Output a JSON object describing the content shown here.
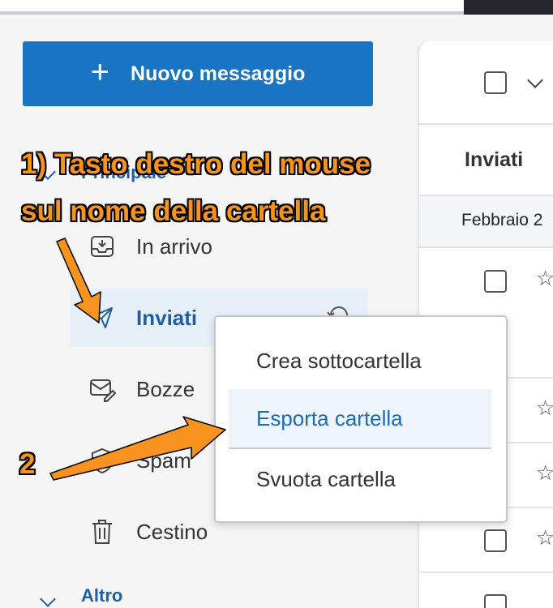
{
  "toolbar": {
    "new_message": "Nuovo messaggio"
  },
  "sidebar": {
    "section_main": "Principale",
    "items": [
      {
        "label": "In arrivo",
        "icon": "inbox-icon"
      },
      {
        "label": "Inviati",
        "icon": "send-icon"
      },
      {
        "label": "Bozze",
        "icon": "drafts-icon"
      },
      {
        "label": "Spam",
        "icon": "spam-shield-icon"
      },
      {
        "label": "Cestino",
        "icon": "trash-icon"
      }
    ],
    "section_other": "Altro"
  },
  "list": {
    "folder_title": "Inviati",
    "date_group": "Febbraio 2"
  },
  "context_menu": {
    "items": [
      "Crea sottocartella",
      "Esporta cartella",
      "Svuota cartella"
    ],
    "highlighted": "Esporta cartella"
  },
  "annotations": {
    "step1_line1": "1) Tasto destro del mouse",
    "step1_line2": "sul nome della cartella",
    "step2": "2"
  },
  "colors": {
    "accent": "#1a74c4",
    "arrow": "#f7931e",
    "active_bg": "#e7eff8"
  }
}
